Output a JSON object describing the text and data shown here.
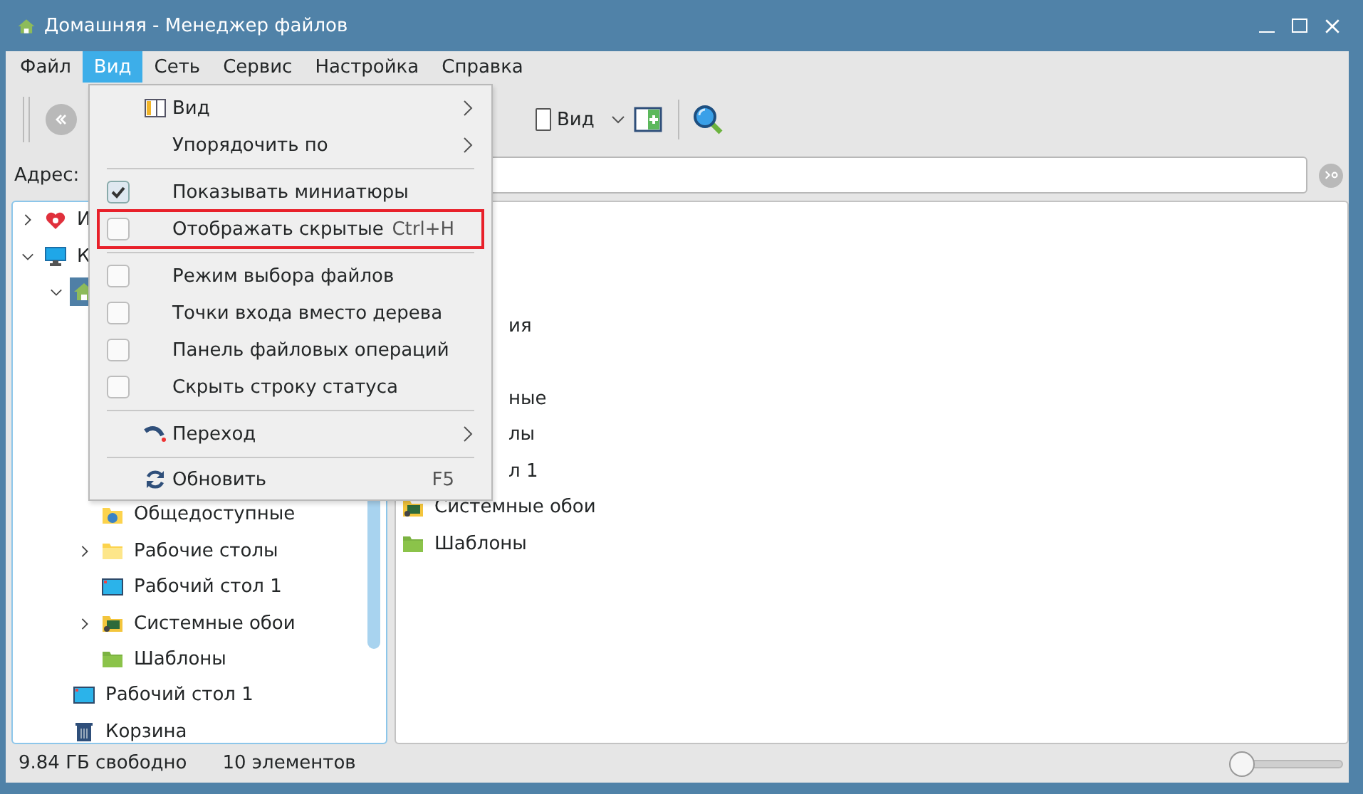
{
  "window": {
    "title": "Домашняя - Менеджер файлов"
  },
  "menu_bar": [
    {
      "label": "Файл",
      "selected": false
    },
    {
      "label": "Вид",
      "selected": true
    },
    {
      "label": "Сеть",
      "selected": false
    },
    {
      "label": "Сервис",
      "selected": false
    },
    {
      "label": "Настройка",
      "selected": false
    },
    {
      "label": "Справка",
      "selected": false
    }
  ],
  "toolbar": {
    "view_button": {
      "label": "Вид"
    }
  },
  "address": {
    "label": "Адрес:"
  },
  "tree": [
    {
      "label": "И",
      "kind": "favorites",
      "expanded": false
    },
    {
      "label": "К",
      "kind": "computer",
      "expanded": true,
      "children": [
        {
          "kind": "home",
          "selected": true,
          "expanded": true,
          "children": [
            {
              "label": "Общедоступные",
              "kind": "shared"
            },
            {
              "label": "Рабочие столы",
              "kind": "folder",
              "expanded": false
            },
            {
              "label": "Рабочий стол 1",
              "kind": "desktop"
            },
            {
              "label": "Системные обои",
              "kind": "wallpaper",
              "expanded": false
            },
            {
              "label": "Шаблоны",
              "kind": "templates"
            }
          ]
        },
        {
          "label": "Рабочий стол 1",
          "kind": "desktop"
        },
        {
          "label": "Корзина",
          "kind": "trash"
        }
      ]
    }
  ],
  "files": [
    {
      "label": "ия",
      "covered": true
    },
    {
      "label": "ные",
      "covered": true
    },
    {
      "label": "лы",
      "covered": true
    },
    {
      "label": "л 1",
      "covered": true
    },
    {
      "label": "Системные обои",
      "kind": "wallpaper",
      "covered": false
    },
    {
      "label": "Шаблоны",
      "kind": "templates",
      "covered": false
    }
  ],
  "view_menu": [
    {
      "kind": "submenu",
      "label": "Вид"
    },
    {
      "kind": "submenu",
      "label": "Упорядочить по"
    },
    {
      "kind": "separator"
    },
    {
      "kind": "check",
      "label": "Показывать миниатюры",
      "checked": true
    },
    {
      "kind": "check",
      "label": "Отображать скрытые",
      "checked": false,
      "shortcut": "Ctrl+H",
      "highlighted": true
    },
    {
      "kind": "separator"
    },
    {
      "kind": "check",
      "label": "Режим выбора файлов",
      "checked": false
    },
    {
      "kind": "check",
      "label": "Точки входа вместо дерева",
      "checked": false
    },
    {
      "kind": "check",
      "label": "Панель файловых операций",
      "checked": false
    },
    {
      "kind": "check",
      "label": "Скрыть строку статуса",
      "checked": false
    },
    {
      "kind": "separator"
    },
    {
      "kind": "submenu",
      "label": "Переход"
    },
    {
      "kind": "separator"
    },
    {
      "kind": "action",
      "label": "Обновить",
      "shortcut": "F5"
    }
  ],
  "status_bar": {
    "free_space": "9.84 ГБ свободно",
    "count": "10 элементов",
    "zoom": {
      "level": 0
    }
  }
}
